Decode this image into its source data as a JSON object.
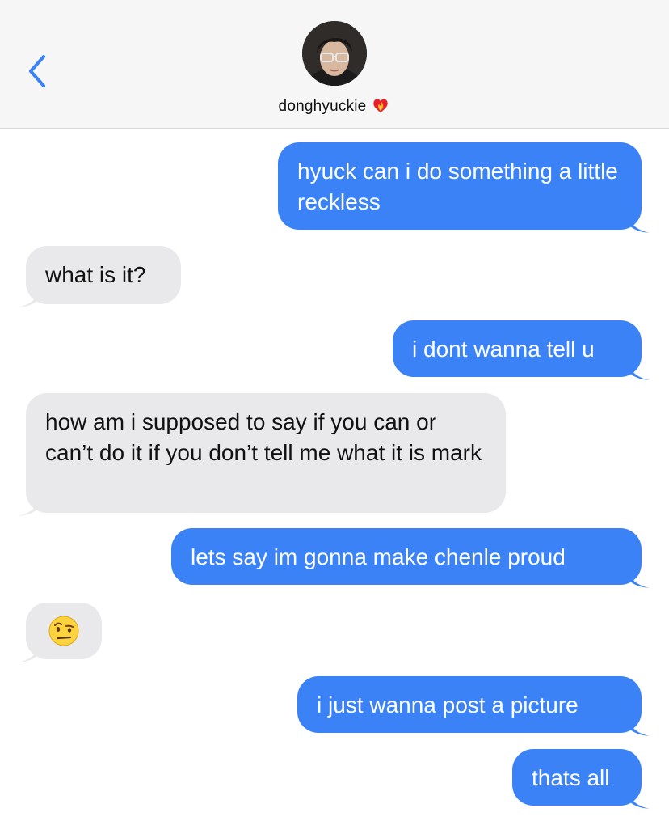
{
  "header": {
    "contact_name": "donghyuckie",
    "icons": {
      "back": "chevron-left-icon",
      "heart": "heart-on-fire-emoji"
    }
  },
  "colors": {
    "sent_bubble": "#3a82f6",
    "received_bubble": "#e9e9eb",
    "accent": "#3a82f6"
  },
  "messages": [
    {
      "side": "sent",
      "text": "hyuck can i do something a little reckless"
    },
    {
      "side": "received",
      "text": "what is it?"
    },
    {
      "side": "sent",
      "text": "i dont wanna tell u"
    },
    {
      "side": "received",
      "text": "how am i supposed to say if you can or can’t do it if you don’t tell me what it is mark"
    },
    {
      "side": "sent",
      "text": "lets say im gonna make chenle proud"
    },
    {
      "side": "received",
      "emoji": "face-with-raised-eyebrow"
    },
    {
      "side": "sent",
      "text": "i just wanna post a picture"
    },
    {
      "side": "sent",
      "text": "thats all"
    }
  ]
}
